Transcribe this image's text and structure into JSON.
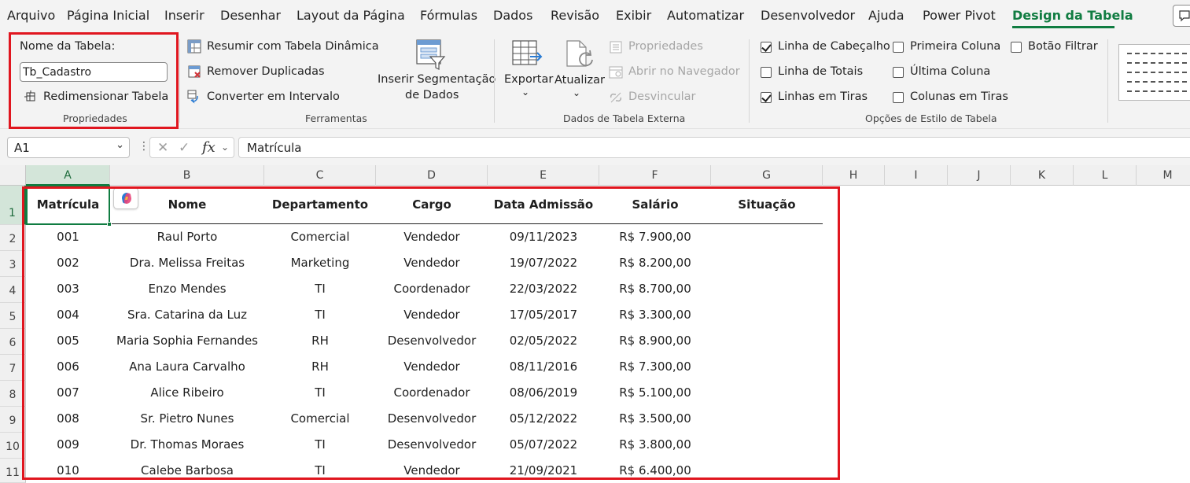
{
  "menu": {
    "tabs": [
      "Arquivo",
      "Página Inicial",
      "Inserir",
      "Desenhar",
      "Layout da Página",
      "Fórmulas",
      "Dados",
      "Revisão",
      "Exibir",
      "Automatizar",
      "Desenvolvedor",
      "Ajuda",
      "Power Pivot",
      "Design da Tabela"
    ],
    "active_tab": "Design da Tabela"
  },
  "ribbon": {
    "properties": {
      "table_name_label": "Nome da Tabela:",
      "table_name_value": "Tb_Cadastro",
      "resize_label": "Redimensionar Tabela",
      "group_label": "Propriedades"
    },
    "tools": {
      "summarize_pivot": "Resumir com Tabela Dinâmica",
      "remove_duplicates": "Remover Duplicadas",
      "convert_to_range": "Converter em Intervalo",
      "insert_slicer_line1": "Inserir Segmentação",
      "insert_slicer_line2": "de Dados",
      "group_label": "Ferramentas"
    },
    "external_data": {
      "export": "Exportar",
      "refresh": "Atualizar",
      "properties": "Propriedades",
      "open_in_browser": "Abrir no Navegador",
      "unlink": "Desvincular",
      "group_label": "Dados de Tabela Externa"
    },
    "style_options": {
      "header_row": {
        "label": "Linha de Cabeçalho",
        "checked": true
      },
      "total_row": {
        "label": "Linha de Totais",
        "checked": false
      },
      "banded_rows": {
        "label": "Linhas em Tiras",
        "checked": true
      },
      "first_column": {
        "label": "Primeira Coluna",
        "checked": false
      },
      "last_column": {
        "label": "Última Coluna",
        "checked": false
      },
      "banded_columns": {
        "label": "Colunas em Tiras",
        "checked": false
      },
      "filter_button": {
        "label": "Botão Filtrar",
        "checked": false
      },
      "group_label": "Opções de Estilo de Tabela"
    }
  },
  "formula_bar": {
    "name_box": "A1",
    "fx": "fx",
    "formula": "Matrícula"
  },
  "grid": {
    "columns": [
      "A",
      "B",
      "C",
      "D",
      "E",
      "F",
      "G",
      "H",
      "I",
      "J",
      "K",
      "L",
      "M"
    ],
    "rows": [
      "1",
      "2",
      "3",
      "4",
      "5",
      "6",
      "7",
      "8",
      "9",
      "10",
      "11"
    ],
    "table_headers": [
      "Matrícula",
      "Nome",
      "Departamento",
      "Cargo",
      "Data Admissão",
      "Salário",
      "Situação"
    ],
    "table_rows": [
      [
        "001",
        "Raul Porto",
        "Comercial",
        "Vendedor",
        "09/11/2023",
        "R$ 7.900,00",
        ""
      ],
      [
        "002",
        "Dra. Melissa Freitas",
        "Marketing",
        "Vendedor",
        "19/07/2022",
        "R$ 8.200,00",
        ""
      ],
      [
        "003",
        "Enzo Mendes",
        "TI",
        "Coordenador",
        "22/03/2022",
        "R$ 8.700,00",
        ""
      ],
      [
        "004",
        "Sra. Catarina da Luz",
        "TI",
        "Vendedor",
        "17/05/2017",
        "R$ 3.300,00",
        ""
      ],
      [
        "005",
        "Maria Sophia Fernandes",
        "RH",
        "Desenvolvedor",
        "02/05/2022",
        "R$ 8.900,00",
        ""
      ],
      [
        "006",
        "Ana Laura Carvalho",
        "RH",
        "Vendedor",
        "08/11/2016",
        "R$ 7.300,00",
        ""
      ],
      [
        "007",
        "Alice Ribeiro",
        "TI",
        "Coordenador",
        "08/06/2019",
        "R$ 5.100,00",
        ""
      ],
      [
        "008",
        "Sr. Pietro Nunes",
        "Comercial",
        "Desenvolvedor",
        "05/12/2022",
        "R$ 3.500,00",
        ""
      ],
      [
        "009",
        "Dr. Thomas Moraes",
        "TI",
        "Desenvolvedor",
        "05/07/2022",
        "R$ 3.800,00",
        ""
      ],
      [
        "010",
        "Calebe Barbosa",
        "TI",
        "Vendedor",
        "21/09/2021",
        "R$ 6.400,00",
        ""
      ]
    ]
  },
  "colors": {
    "accent": "#107c41",
    "highlight": "#e0161f"
  }
}
